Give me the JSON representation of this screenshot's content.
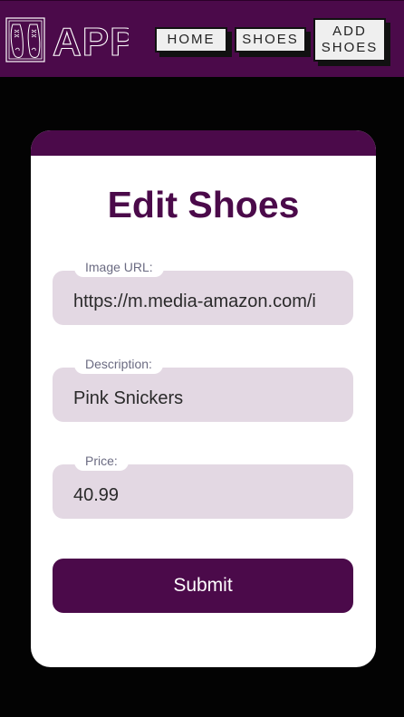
{
  "navbar": {
    "logo_text": "APP",
    "home_label": "HOME",
    "shoes_label": "SHOES",
    "add_shoes_label": "ADD\nSHOES"
  },
  "form": {
    "title": "Edit Shoes",
    "image_url": {
      "label": "Image URL:",
      "value": "https://m.media-amazon.com/i"
    },
    "description": {
      "label": "Description:",
      "value": "Pink Snickers"
    },
    "price": {
      "label": "Price:",
      "value": "40.99"
    },
    "submit_label": "Submit"
  },
  "colors": {
    "brand_purple": "#4b0a4a",
    "input_bg": "#e3d8e3",
    "page_bg": "#030303"
  }
}
